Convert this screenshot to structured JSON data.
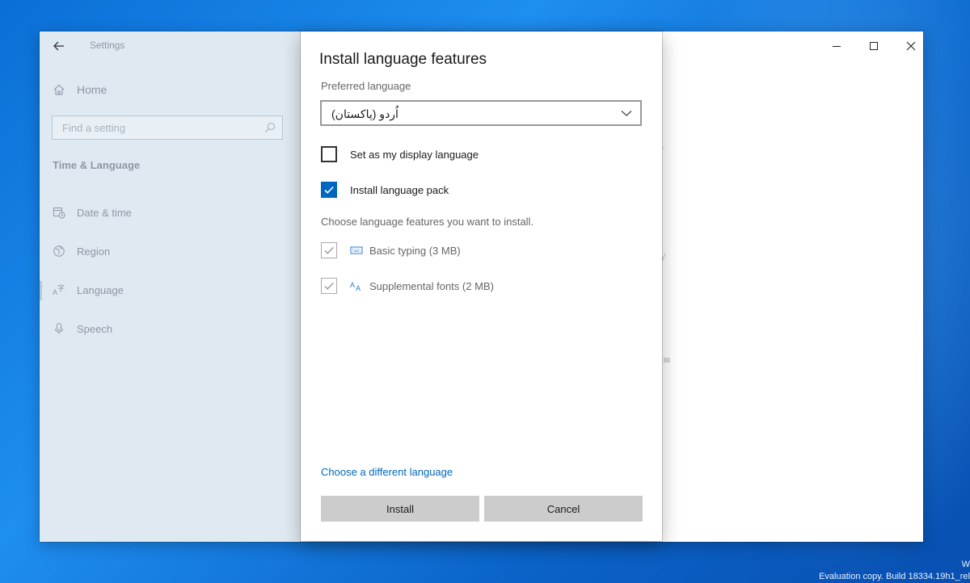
{
  "window": {
    "app_title": "Settings"
  },
  "sidebar": {
    "home_label": "Home",
    "search_placeholder": "Find a setting",
    "section_title": "Time & Language",
    "items": [
      {
        "label": "Date & time",
        "icon": "calendar-clock-icon"
      },
      {
        "label": "Region",
        "icon": "globe-icon"
      },
      {
        "label": "Language",
        "icon": "language-icon",
        "active": true
      },
      {
        "label": "Speech",
        "icon": "microphone-icon"
      }
    ]
  },
  "background_peek": {
    "text_1": "r",
    "text_2": "y"
  },
  "dialog": {
    "title": "Install language features",
    "preferred_label": "Preferred language",
    "preferred_value": "اُردو (پاکستان)",
    "options": [
      {
        "label": "Set as my display language",
        "checked": false
      },
      {
        "label": "Install language pack",
        "checked": true
      }
    ],
    "features_hint": "Choose language features you want to install.",
    "features": [
      {
        "label": "Basic typing (3 MB)",
        "icon": "keyboard-icon",
        "checked": true
      },
      {
        "label": "Supplemental fonts (2 MB)",
        "icon": "font-icon",
        "checked": true
      }
    ],
    "link_label": "Choose a different language",
    "install_label": "Install",
    "cancel_label": "Cancel"
  },
  "desktop": {
    "watermark_line_1": "W",
    "watermark_line_2": "Evaluation copy. Build 18334.19h1_rel"
  },
  "colors": {
    "accent": "#0067c0",
    "link": "#0067b8",
    "sidebar_bg": "#dfe9f1"
  }
}
